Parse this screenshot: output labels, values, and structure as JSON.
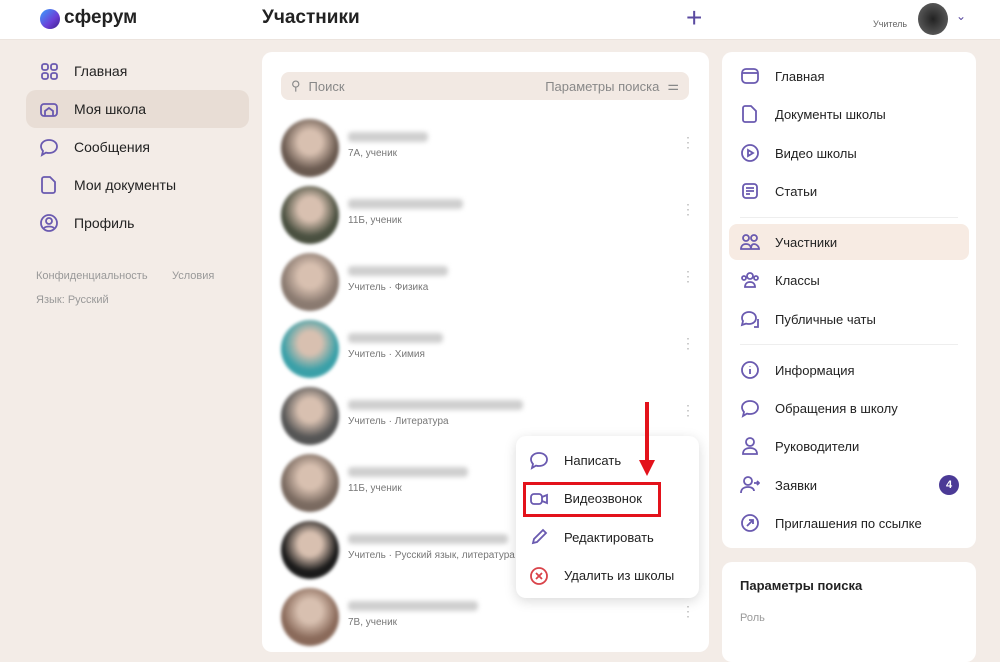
{
  "header": {
    "logo": "сферум",
    "title": "Участники",
    "user_role": "Учитель"
  },
  "left_nav": {
    "items": [
      {
        "label": "Главная",
        "icon": "grid-icon"
      },
      {
        "label": "Моя школа",
        "icon": "school-icon",
        "active": true
      },
      {
        "label": "Сообщения",
        "icon": "message-icon"
      },
      {
        "label": "Мои документы",
        "icon": "document-icon"
      },
      {
        "label": "Профиль",
        "icon": "profile-icon"
      }
    ],
    "footer": {
      "privacy": "Конфиденциальность",
      "terms": "Условия",
      "language": "Язык: Русский"
    }
  },
  "search": {
    "placeholder": "Поиск",
    "params": "Параметры поиска"
  },
  "members": [
    {
      "subtitle": "7А, ученик",
      "color": "#6a5a50"
    },
    {
      "subtitle": "11Б, ученик",
      "color": "#4a5040"
    },
    {
      "subtitle": "Учитель · Физика",
      "color": "#8a7a70"
    },
    {
      "subtitle": "Учитель · Химия",
      "color": "#3aa0a8"
    },
    {
      "subtitle": "Учитель · Литература",
      "color": "#555"
    },
    {
      "subtitle": "11Б, ученик",
      "color": "#7a6a60"
    },
    {
      "subtitle": "Учитель · Русский язык, литература",
      "color": "#1a1a1a"
    },
    {
      "subtitle": "7В, ученик",
      "color": "#8a6a5a"
    }
  ],
  "context_menu": [
    {
      "label": "Написать",
      "icon": "message-icon"
    },
    {
      "label": "Видеозвонок",
      "icon": "video-camera-icon",
      "highlighted": true
    },
    {
      "label": "Редактировать",
      "icon": "pencil-icon"
    },
    {
      "label": "Удалить из школы",
      "icon": "delete-circle-icon"
    }
  ],
  "right_nav": {
    "groups": [
      [
        {
          "label": "Главная",
          "icon": "window-icon"
        },
        {
          "label": "Документы школы",
          "icon": "document-icon"
        },
        {
          "label": "Видео школы",
          "icon": "play-icon"
        },
        {
          "label": "Статьи",
          "icon": "article-icon"
        }
      ],
      [
        {
          "label": "Участники",
          "icon": "users-icon",
          "active": true
        },
        {
          "label": "Классы",
          "icon": "classes-icon"
        },
        {
          "label": "Публичные чаты",
          "icon": "chats-icon"
        }
      ],
      [
        {
          "label": "Информация",
          "icon": "info-icon"
        },
        {
          "label": "Обращения в школу",
          "icon": "message-icon"
        },
        {
          "label": "Руководители",
          "icon": "user-icon"
        },
        {
          "label": "Заявки",
          "icon": "user-arrow-icon",
          "badge": "4"
        },
        {
          "label": "Приглашения по ссылке",
          "icon": "link-arrow-icon"
        }
      ]
    ]
  },
  "search_params": {
    "title": "Параметры поиска",
    "role_label": "Роль"
  },
  "colors": {
    "accent": "#6a5ab0",
    "highlight": "#e3121b",
    "badge": "#4b3a96"
  }
}
